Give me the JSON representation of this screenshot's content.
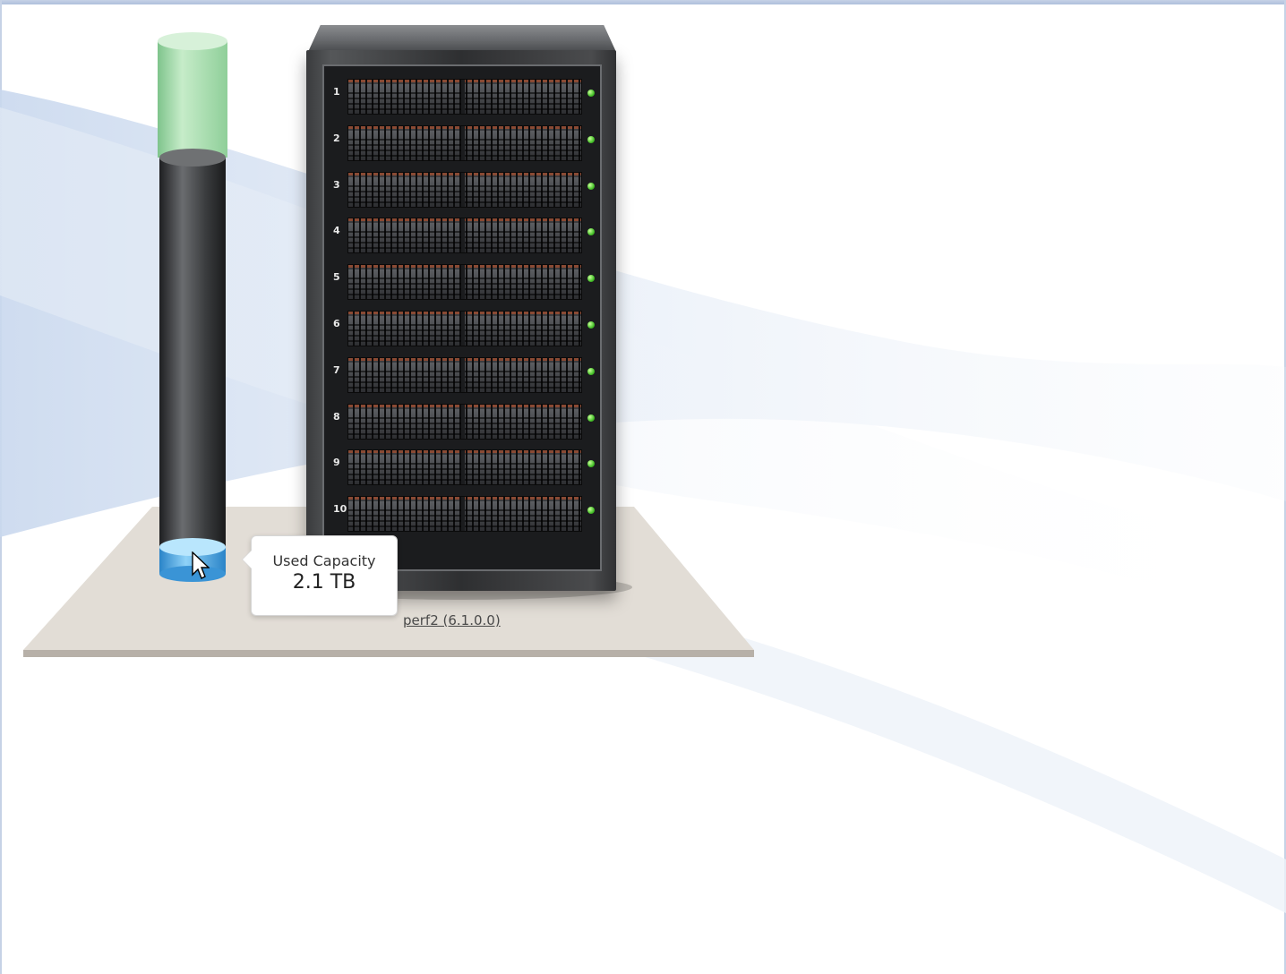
{
  "gauge": {
    "used_fraction": 0.06,
    "free_color": "#a8dcb0",
    "used_color": "#4aa6e0",
    "body_color": "#3a3c3e"
  },
  "tooltip": {
    "label": "Used Capacity",
    "value": "2.1 TB"
  },
  "rack": {
    "enclosures": [
      "1",
      "2",
      "3",
      "4",
      "5",
      "6",
      "7",
      "8",
      "9",
      "10"
    ],
    "status_color": "#47c22a"
  },
  "system": {
    "link_text": "perf2 (6.1.0.0)"
  },
  "icons": {
    "cursor": "arrow-pointer-icon",
    "status": "status-led-icon"
  }
}
